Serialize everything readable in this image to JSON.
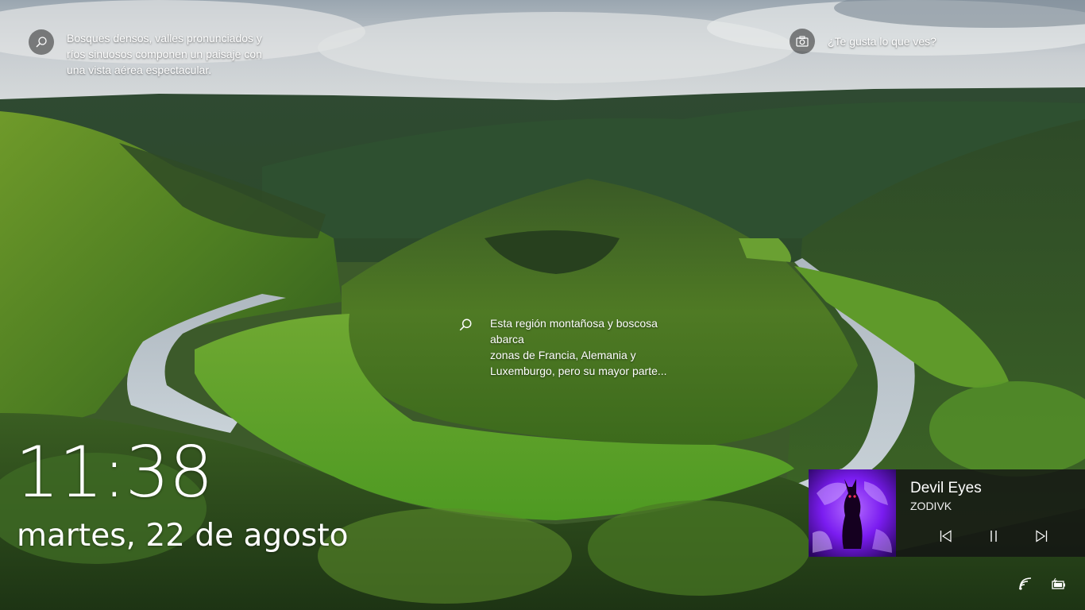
{
  "spotlight": {
    "top_left": {
      "icon": "magnifier-icon",
      "text_lines": [
        "Bosques densos, valles pronunciados y",
        "ríos sinuosos componen un paisaje con",
        "una vista aérea espectacular."
      ]
    },
    "top_right": {
      "icon": "camera-icon",
      "text": "¿Te gusta lo que ves?"
    },
    "center": {
      "icon": "magnifier-icon",
      "text_lines": [
        "Esta región montañosa y boscosa abarca",
        "zonas de Francia, Alemania y",
        "Luxemburgo, pero su mayor parte..."
      ]
    }
  },
  "clock": {
    "time": "11:38",
    "date": "martes, 22 de agosto"
  },
  "media": {
    "title": "Devil Eyes",
    "artist": "ZODIVK",
    "controls": [
      "previous-track",
      "play-pause",
      "next-track"
    ]
  },
  "tray": {
    "icons": [
      "network-icon",
      "battery-icon"
    ]
  },
  "colors": {
    "media_panel": "#141414",
    "album_art_accent": "#7a1cf0",
    "text": "#ffffff"
  }
}
